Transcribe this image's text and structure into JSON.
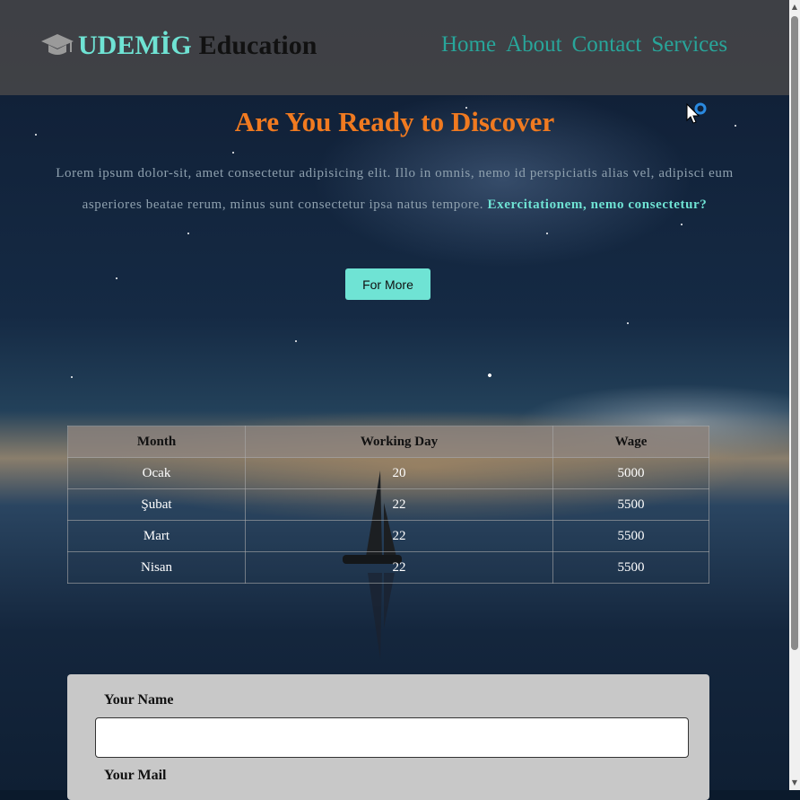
{
  "header": {
    "brand_primary": "UDEMİG",
    "brand_secondary": "Education",
    "logo_icon": "graduation-cap-icon",
    "nav": [
      {
        "label": "Home"
      },
      {
        "label": "About"
      },
      {
        "label": "Contact"
      },
      {
        "label": "Services"
      }
    ]
  },
  "hero": {
    "title": "Are You Ready to Discover",
    "text": "Lorem ipsum dolor-sit, amet consectetur adipisicing elit. Illo in omnis, nemo id perspiciatis alias vel, adipisci eum asperiores beatae rerum, minus sunt consectetur ipsa natus tempore.",
    "emphasis": "Exercitationem, nemo consectetur?",
    "button_label": "For More"
  },
  "table": {
    "headers": [
      "Month",
      "Working Day",
      "Wage"
    ],
    "rows": [
      [
        "Ocak",
        "20",
        "5000"
      ],
      [
        "Şubat",
        "22",
        "5500"
      ],
      [
        "Mart",
        "22",
        "5500"
      ],
      [
        "Nisan",
        "22",
        "5500"
      ]
    ]
  },
  "form": {
    "name_label": "Your Name",
    "name_value": "",
    "mail_label": "Your Mail"
  },
  "colors": {
    "accent": "#6fe3d4",
    "nav_link": "#28a59a",
    "title": "#f07a20",
    "header_bg": "#464648"
  }
}
